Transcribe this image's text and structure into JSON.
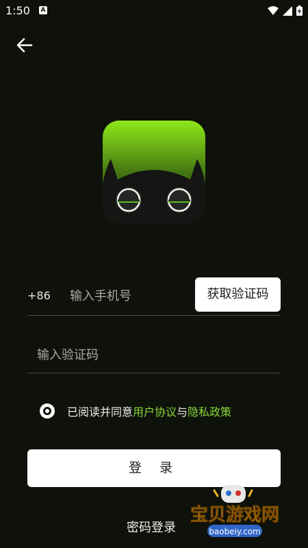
{
  "status_bar": {
    "time": "1:50",
    "app_icon_label": "A"
  },
  "back_icon": "arrow-left-icon",
  "phone": {
    "country_code": "+86",
    "placeholder": "输入手机号",
    "value": "",
    "get_code_label": "获取验证码"
  },
  "code": {
    "placeholder": "输入验证码",
    "value": ""
  },
  "agreement": {
    "prefix": "已阅读并同意",
    "user_agreement": "用户协议",
    "and": "与",
    "privacy_policy": "隐私政策",
    "checked": true
  },
  "login_label": "登 录",
  "password_login_label": "密码登录",
  "watermark": {
    "name": "宝贝游戏网",
    "url": "baobeiy.com"
  },
  "colors": {
    "background": "#0e120a",
    "accent": "#8ad83a",
    "logo_green": "#8ee81a"
  }
}
